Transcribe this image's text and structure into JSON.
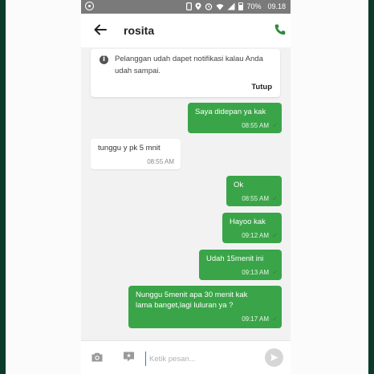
{
  "status_bar": {
    "battery": "70%",
    "time": "09.18"
  },
  "header": {
    "title": "rosita",
    "back_icon": "arrow-left-icon",
    "call_icon": "phone-icon"
  },
  "notice": {
    "icon": "info-icon",
    "text": "Pelanggan udah dapet notifikasi kalau Anda udah sampai.",
    "close_label": "Tutup"
  },
  "messages": [
    {
      "direction": "out",
      "text": "Saya didepan ya kak",
      "time": "08:55 AM",
      "read": true
    },
    {
      "direction": "in",
      "text": "tunggu y pk 5 mnit",
      "time": "08:55 AM"
    },
    {
      "direction": "out",
      "text": "Ok",
      "time": "08:55 AM",
      "read": true
    },
    {
      "direction": "out",
      "text": "Hayoo kak",
      "time": "09:12 AM",
      "read": true
    },
    {
      "direction": "out",
      "text": "Udah 15menit ini",
      "time": "09:13 AM",
      "read": true
    },
    {
      "direction": "out",
      "text": "Nunggu 5menit apa 30 menit kak\nlama banget,lagi luluran ya ?",
      "time": "09:17 AM",
      "read": true
    }
  ],
  "composer": {
    "placeholder": "Ketik pesan...",
    "value": "",
    "camera_icon": "camera-icon",
    "sticker_icon": "sticker-icon",
    "send_icon": "send-icon"
  },
  "colors": {
    "accent_green": "#3aa548",
    "status_bar": "#7a7a7a",
    "outer_frame": "#0b3b2c"
  }
}
